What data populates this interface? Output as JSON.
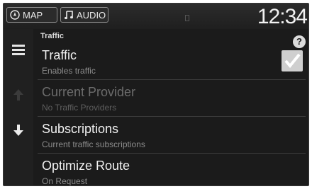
{
  "header": {
    "map_label": "MAP",
    "audio_label": "AUDIO",
    "clock": "12:34"
  },
  "breadcrumb": "Traffic",
  "help_label": "?",
  "items": [
    {
      "title": "Traffic",
      "subtitle": "Enables traffic",
      "checked": true,
      "enabled": true
    },
    {
      "title": "Current Provider",
      "subtitle": "No Traffic Providers",
      "enabled": false
    },
    {
      "title": "Subscriptions",
      "subtitle": "Current traffic subscriptions",
      "enabled": true
    },
    {
      "title": "Optimize Route",
      "subtitle": "On Request",
      "enabled": true
    }
  ]
}
